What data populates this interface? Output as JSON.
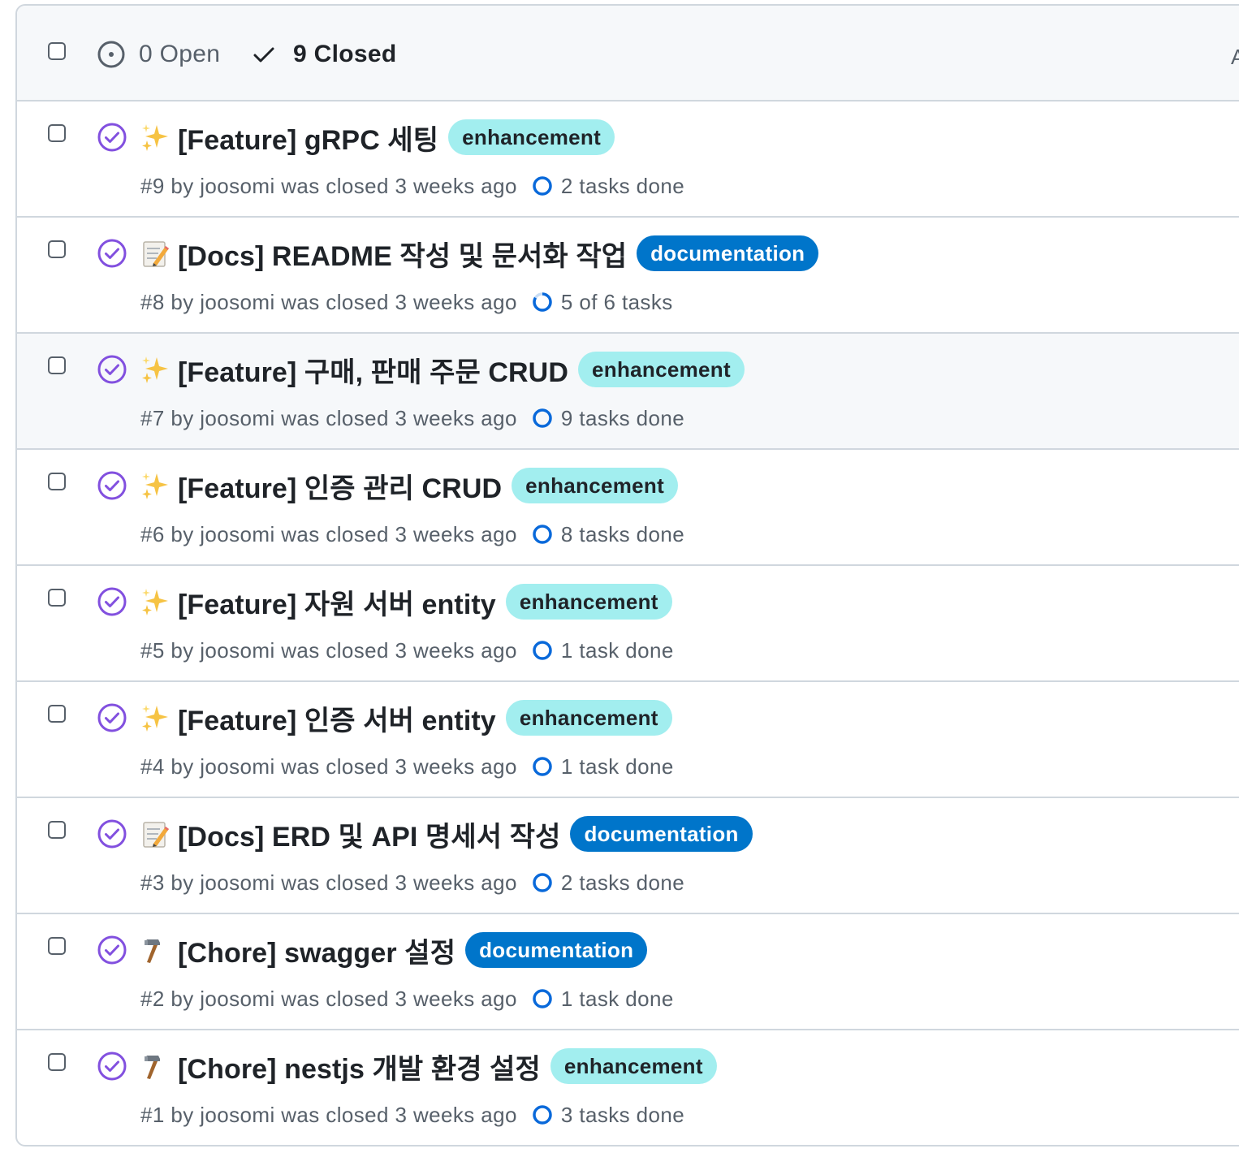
{
  "header": {
    "open_count_label": "0 Open",
    "closed_count_label": "9 Closed",
    "open_icon": "issue-opened-icon",
    "closed_icon": "check-icon",
    "edge_glyph": "A"
  },
  "colors": {
    "closed_purple": "#8250df",
    "progress_blue": "#0969da",
    "enhancement_bg": "#a2eeef",
    "documentation_bg": "#0075ca",
    "border": "#d0d7de"
  },
  "issues": [
    {
      "emoji": "sparkles",
      "title": "[Feature] gRPC 세팅",
      "label": "enhancement",
      "meta": "#9 by joosomi was closed 3 weeks ago",
      "tasks": "2 tasks done",
      "progress": 1.0
    },
    {
      "emoji": "memo",
      "title": "[Docs] README 작성 및 문서화 작업",
      "label": "documentation",
      "meta": "#8 by joosomi was closed 3 weeks ago",
      "tasks": "5 of 6 tasks",
      "progress": 0.8333
    },
    {
      "emoji": "sparkles",
      "title": "[Feature] 구매, 판매 주문 CRUD",
      "label": "enhancement",
      "meta": "#7 by joosomi was closed 3 weeks ago",
      "tasks": "9 tasks done",
      "progress": 1.0
    },
    {
      "emoji": "sparkles",
      "title": "[Feature] 인증 관리 CRUD",
      "label": "enhancement",
      "meta": "#6 by joosomi was closed 3 weeks ago",
      "tasks": "8 tasks done",
      "progress": 1.0
    },
    {
      "emoji": "sparkles",
      "title": "[Feature] 자원 서버 entity",
      "label": "enhancement",
      "meta": "#5 by joosomi was closed 3 weeks ago",
      "tasks": "1 task done",
      "progress": 1.0
    },
    {
      "emoji": "sparkles",
      "title": "[Feature] 인증 서버 entity",
      "label": "enhancement",
      "meta": "#4 by joosomi was closed 3 weeks ago",
      "tasks": "1 task done",
      "progress": 1.0
    },
    {
      "emoji": "memo",
      "title": "[Docs] ERD 및 API 명세서 작성",
      "label": "documentation",
      "meta": "#3 by joosomi was closed 3 weeks ago",
      "tasks": "2 tasks done",
      "progress": 1.0
    },
    {
      "emoji": "hammer",
      "title": "[Chore] swagger 설정",
      "label": "documentation",
      "meta": "#2 by joosomi was closed 3 weeks ago",
      "tasks": "1 task done",
      "progress": 1.0
    },
    {
      "emoji": "hammer",
      "title": "[Chore] nestjs 개발 환경 설정",
      "label": "enhancement",
      "meta": "#1 by joosomi was closed 3 weeks ago",
      "tasks": "3 tasks done",
      "progress": 1.0
    }
  ]
}
